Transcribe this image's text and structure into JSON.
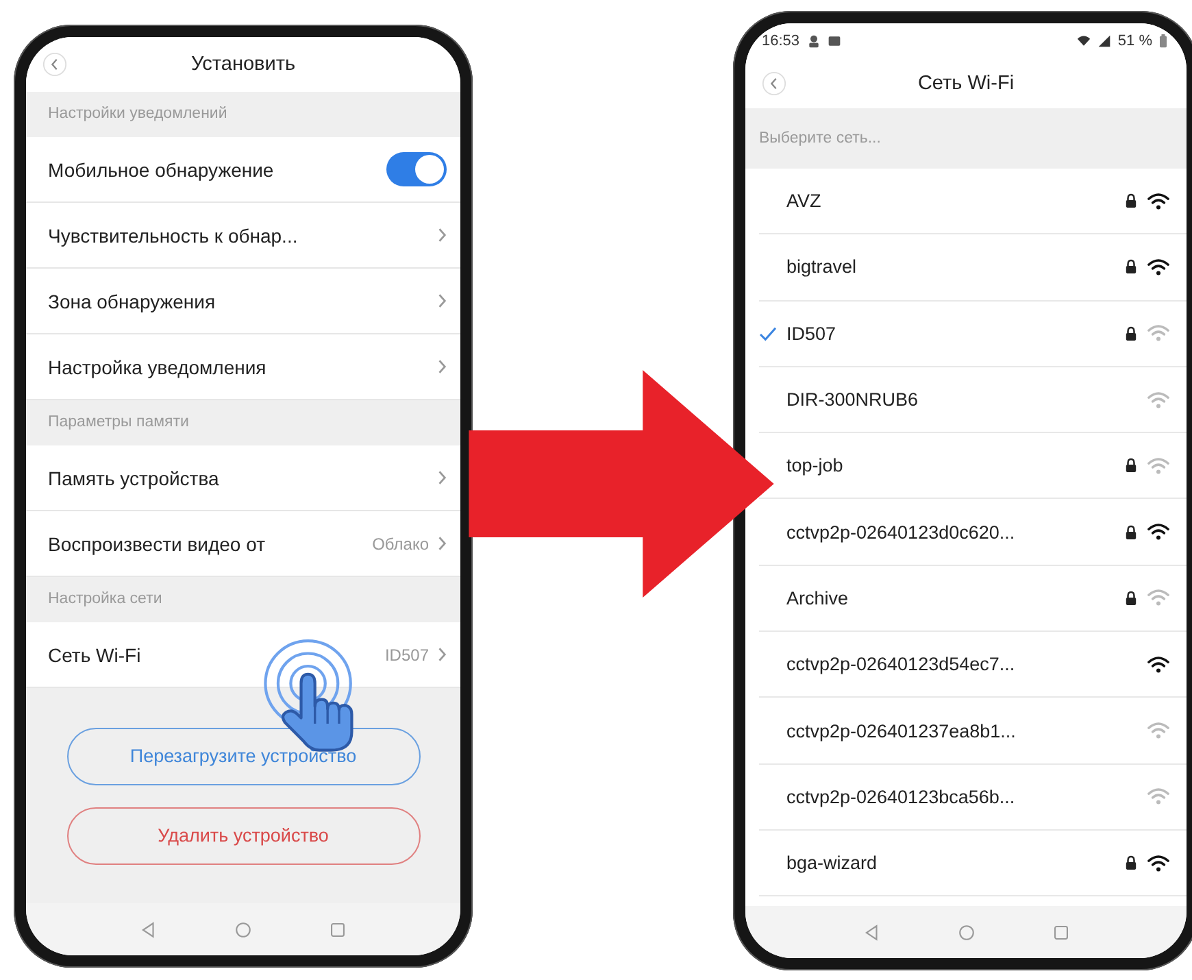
{
  "left_screen": {
    "title": "Установить",
    "sections": [
      {
        "header": "Настройки уведомлений",
        "rows": [
          {
            "kind": "toggle",
            "label": "Мобильное обнаружение",
            "on": true
          },
          {
            "kind": "link",
            "label": "Чувствительность к обнар..."
          },
          {
            "kind": "link",
            "label": "Зона обнаружения"
          },
          {
            "kind": "link",
            "label": "Настройка уведомления"
          }
        ]
      },
      {
        "header": "Параметры памяти",
        "rows": [
          {
            "kind": "link",
            "label": "Память устройства"
          },
          {
            "kind": "link",
            "label": "Воспроизвести видео от",
            "value": "Облако"
          }
        ]
      },
      {
        "header": "Настройка сети",
        "rows": [
          {
            "kind": "link",
            "label": "Сеть Wi-Fi",
            "value": "ID507"
          }
        ]
      }
    ],
    "buttons": [
      {
        "kind": "primary",
        "label": "Перезагрузите устройство"
      },
      {
        "kind": "danger",
        "label": "Удалить устройство"
      }
    ]
  },
  "right_screen": {
    "status_bar": {
      "time": "16:53",
      "battery": "51 %"
    },
    "title": "Сеть Wi-Fi",
    "prompt": "Выберите сеть...",
    "networks": [
      {
        "name": "AVZ",
        "selected": false,
        "locked": true,
        "strong": true
      },
      {
        "name": "bigtravel",
        "selected": false,
        "locked": true,
        "strong": true
      },
      {
        "name": "ID507",
        "selected": true,
        "locked": true,
        "strong": false
      },
      {
        "name": "DIR-300NRUB6",
        "selected": false,
        "locked": false,
        "strong": false
      },
      {
        "name": "top-job",
        "selected": false,
        "locked": true,
        "strong": false
      },
      {
        "name": "cctvp2p-02640123d0c620...",
        "selected": false,
        "locked": true,
        "strong": true
      },
      {
        "name": "Archive",
        "selected": false,
        "locked": true,
        "strong": false
      },
      {
        "name": "cctvp2p-02640123d54ec7...",
        "selected": false,
        "locked": false,
        "strong": true
      },
      {
        "name": "cctvp2p-026401237ea8b1...",
        "selected": false,
        "locked": false,
        "strong": false
      },
      {
        "name": "cctvp2p-02640123bca56b...",
        "selected": false,
        "locked": false,
        "strong": false
      },
      {
        "name": "bga-wizard",
        "selected": false,
        "locked": true,
        "strong": true
      }
    ]
  }
}
